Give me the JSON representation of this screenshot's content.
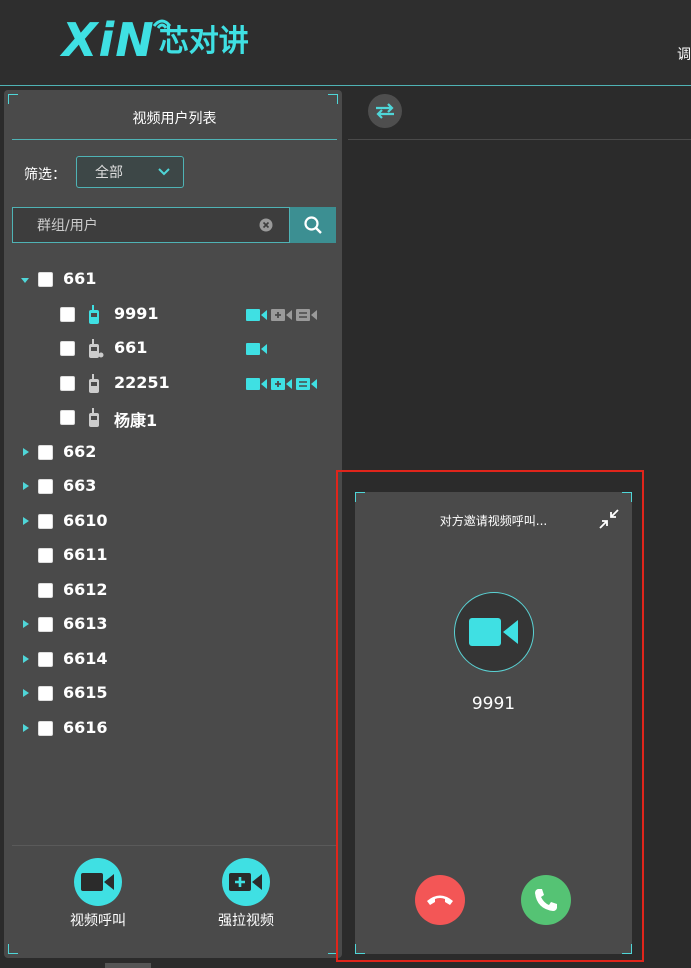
{
  "header": {
    "logo_latin": "XiN",
    "logo_cn": "芯对讲",
    "nav_partial": "调度"
  },
  "left_panel": {
    "title": "视频用户列表",
    "filter_label": "筛选：",
    "filter_value": "全部",
    "search_placeholder": "群组/用户",
    "tree": [
      {
        "label": "661",
        "expanded": true
      },
      {
        "label": "9991"
      },
      {
        "label": "661"
      },
      {
        "label": "22251"
      },
      {
        "label": "杨康1"
      },
      {
        "label": "662"
      },
      {
        "label": "663"
      },
      {
        "label": "6610"
      },
      {
        "label": "6611"
      },
      {
        "label": "6612"
      },
      {
        "label": "6613"
      },
      {
        "label": "6614"
      },
      {
        "label": "6615"
      },
      {
        "label": "6616"
      }
    ],
    "actions": {
      "video_call": "视频呼叫",
      "force_video": "强拉视频"
    }
  },
  "call_dialog": {
    "title": "对方邀请视频呼叫...",
    "caller": "9991"
  },
  "colors": {
    "accent": "#3fe0e3",
    "panel": "#4a4a4a",
    "background": "#2b2b2b",
    "reject": "#f35656",
    "accept": "#55c374",
    "highlight_frame": "#e0251b",
    "inactive_cap": "#9a9a9a"
  }
}
